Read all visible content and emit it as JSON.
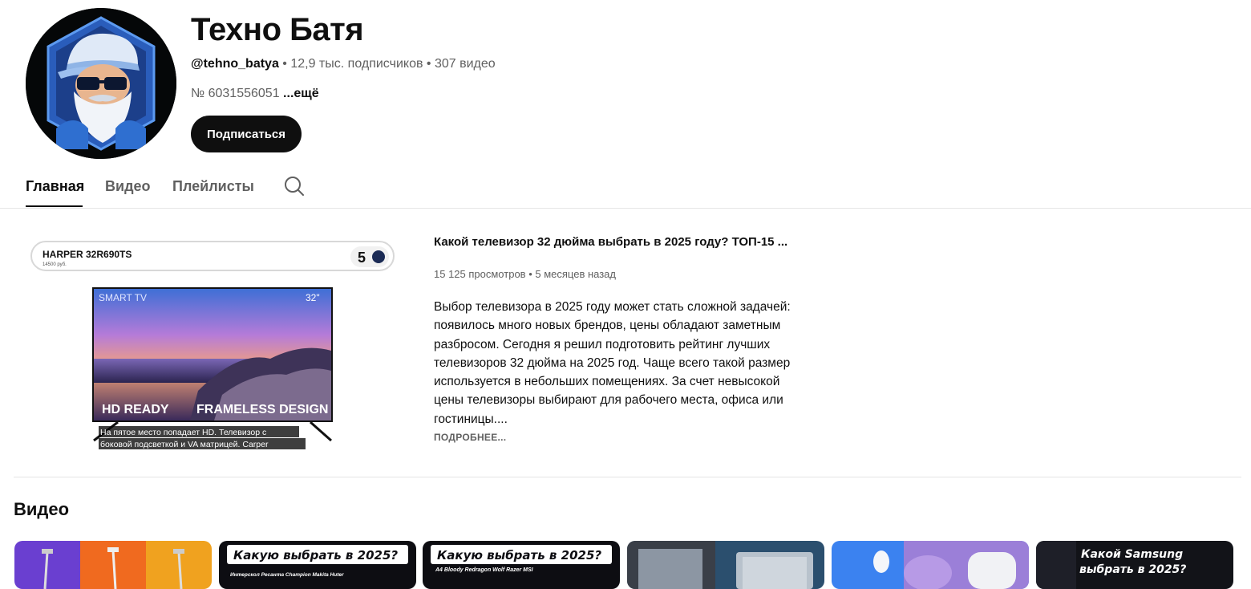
{
  "channel": {
    "title": "Техно Батя",
    "handle": "@tehno_batya",
    "sep1": " • ",
    "subscribers": "12,9 тыс. подписчиков",
    "sep2": " • ",
    "videos_count": "307 видео",
    "description_short": "№ 6031556051 ",
    "description_more": "...ещё",
    "subscribe_label": "Подписаться"
  },
  "tabs": [
    {
      "label": "Главная",
      "active": true
    },
    {
      "label": "Видео",
      "active": false
    },
    {
      "label": "Плейлисты",
      "active": false
    }
  ],
  "icons": {
    "search": "search-icon"
  },
  "featured": {
    "title": "Какой телевизор 32 дюйма выбрать в 2025 году? ТОП-15 ...",
    "views": "15 125 просмотров",
    "stats_sep": " • ",
    "age": "5 месяцев назад",
    "description": "Выбор телевизора в 2025 году может стать сложной задачей: появилось много новых брендов, цены обладают заметным разбросом. Сегодня я решил подготовить рейтинг лучших телевизоров 32 дюйма на 2025 год. Чаще всего такой размер используется в небольших помещениях. За счет невысокой цены телевизоры выбирают для рабочего места, офиса или гостиницы....",
    "read_more": "ПОДРОБНЕЕ...",
    "thumbnail": {
      "model": "HARPER 32R690TS",
      "price": "14500 руб.",
      "rank": "5",
      "tv_label_left": "SMART TV",
      "tv_label_right": "32\"",
      "hd_text": "HD READY",
      "frameless_text": "FRAMELESS DESIGN",
      "caption_line1": "На пятое место попадает HD. Телевизор с",
      "caption_line2": "боковой подсветкой и VA матрицей. Carper"
    }
  },
  "shelf": {
    "heading": "Видео",
    "videos": [
      {
        "overlay_text": "",
        "sub_text": ""
      },
      {
        "overlay_text": "Какую выбрать в 2025?",
        "sub_text": "Интерскол  Ресанта  Champion  Makita  Huter"
      },
      {
        "overlay_text": "Какую выбрать в 2025?",
        "sub_text": "A4 Bloody  Redragon  Wolf  Razer  MSI"
      },
      {
        "overlay_text": "",
        "sub_text": ""
      },
      {
        "overlay_text": "",
        "sub_text": ""
      },
      {
        "overlay_text": "Какой Samsung",
        "sub_text": "выбрать в 2025?"
      }
    ]
  },
  "colors": {
    "primary_text": "#0f0f0f",
    "secondary_text": "#606060",
    "subscribe_bg": "#0f0f0f",
    "avatar_accent": "#2f6fd0"
  }
}
